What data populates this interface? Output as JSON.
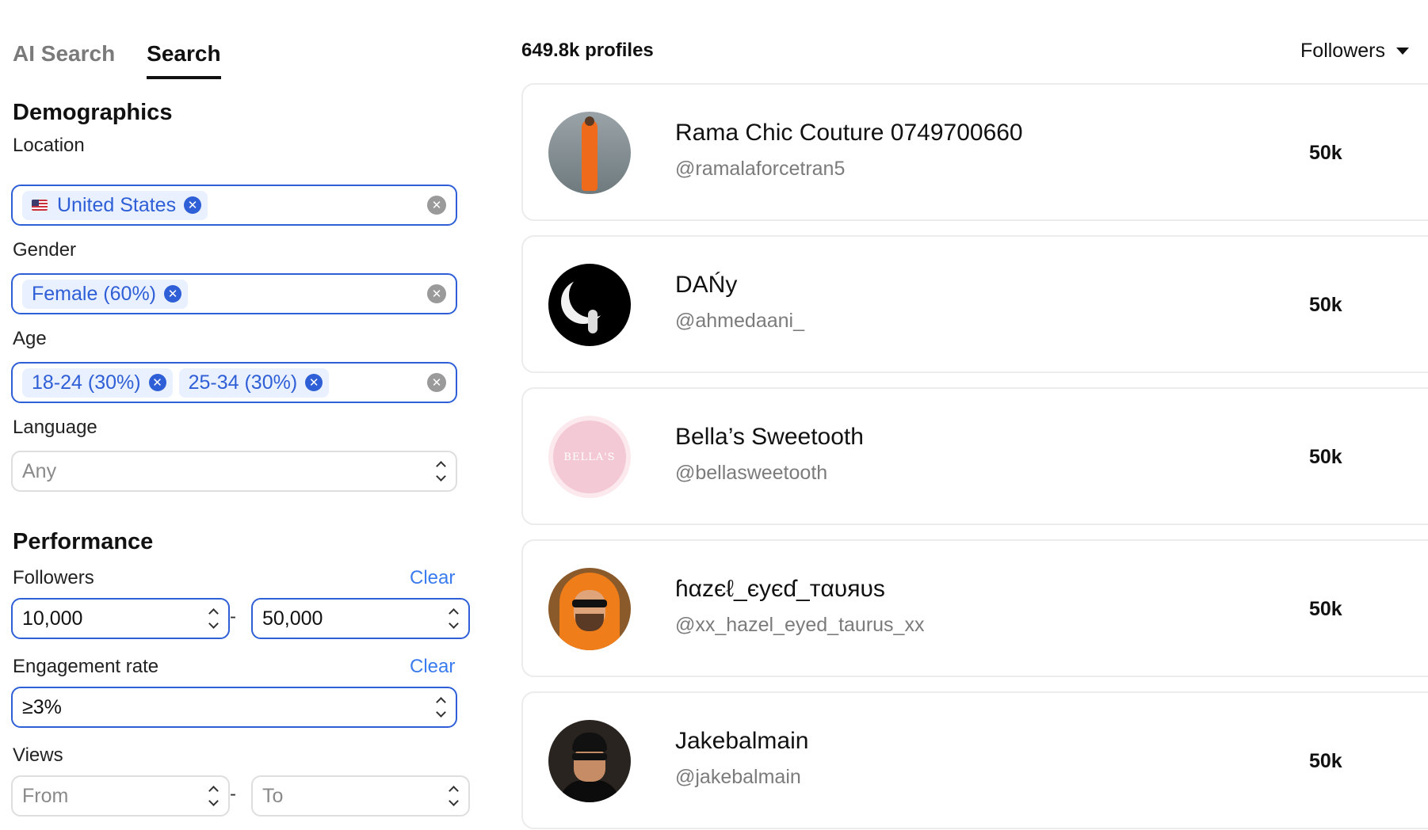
{
  "tabs": [
    {
      "label": "AI Search",
      "active": false
    },
    {
      "label": "Search",
      "active": true
    }
  ],
  "demographics": {
    "title": "Demographics",
    "location": {
      "label": "Location",
      "chips": [
        "United States"
      ]
    },
    "gender": {
      "label": "Gender",
      "chips": [
        "Female (60%)"
      ]
    },
    "age": {
      "label": "Age",
      "chips": [
        "18-24 (30%)",
        "25-34 (30%)"
      ]
    },
    "language": {
      "label": "Language",
      "value": "Any"
    }
  },
  "performance": {
    "title": "Performance",
    "followers": {
      "label": "Followers",
      "clear": "Clear",
      "from": "10,000",
      "to": "50,000",
      "separator": "-"
    },
    "engagement": {
      "label": "Engagement rate",
      "clear": "Clear",
      "value": "≥3%"
    },
    "views": {
      "label": "Views",
      "from": "From",
      "to": "To",
      "separator": "-"
    }
  },
  "results": {
    "count": "649.8k profiles",
    "sort_label": "Followers",
    "profiles": [
      {
        "name": "Rama Chic Couture 0749700660",
        "handle": "@ramalaforcetran5",
        "followers": "50k"
      },
      {
        "name": "DAŃy",
        "handle": "@ahmedaani_",
        "followers": "50k"
      },
      {
        "name": "Bella’s Sweetooth",
        "handle": "@bellasweetooth",
        "followers": "50k"
      },
      {
        "name": "ɦαzєℓ_єуєɗ_тαυяυѕ",
        "handle": "@xx_hazel_eyed_taurus_xx",
        "followers": "50k"
      },
      {
        "name": "Jakebalmain",
        "handle": "@jakebalmain",
        "followers": "50k"
      }
    ],
    "avatar_badge_text": "BELLA'S"
  },
  "icons": {
    "chip_remove": "close-circle-icon",
    "field_clear": "clear-circle-icon",
    "select": "chevron-updown-icon",
    "sort": "caret-down-icon",
    "flag": "us-flag-icon"
  },
  "colors": {
    "accent": "#2f5fd6",
    "chip_bg": "#e9f0ff",
    "link": "#3b7bf0",
    "muted_text": "#7b7b7b"
  }
}
